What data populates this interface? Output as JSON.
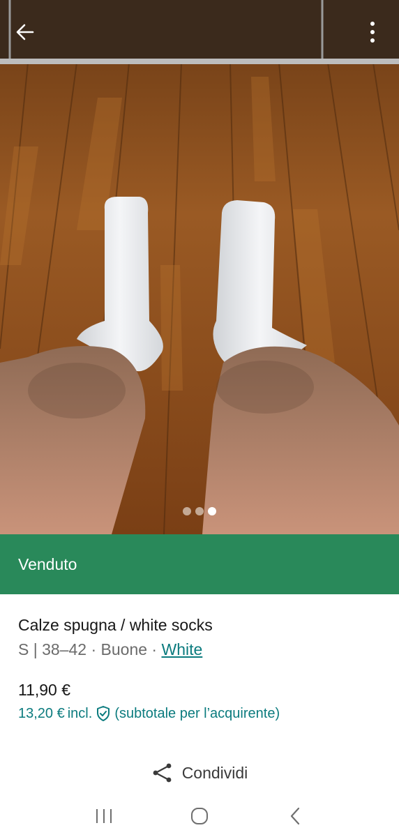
{
  "header": {
    "back_icon": "arrow-left-icon",
    "menu_icon": "more-vertical-icon"
  },
  "gallery": {
    "image_count": 3,
    "active_index": 2
  },
  "status": {
    "label": "Venduto",
    "color": "#29895a"
  },
  "item": {
    "title": "Calze spugna / white socks",
    "size": "S | 38–42",
    "separator_1": "·",
    "condition": "Buone",
    "separator_2": "·",
    "color_link": "White",
    "price": "11,90 €",
    "buyer_price": "13,20 €",
    "buyer_price_incl": "incl.",
    "buyer_price_note": "(subtotale per l’acquirente)",
    "accent_color": "#0b7b7e"
  },
  "share": {
    "label": "Condividi",
    "icon": "share-icon"
  },
  "system_nav": {
    "recent_icon": "recent-apps-icon",
    "home_icon": "home-icon",
    "back_icon": "system-back-icon"
  }
}
